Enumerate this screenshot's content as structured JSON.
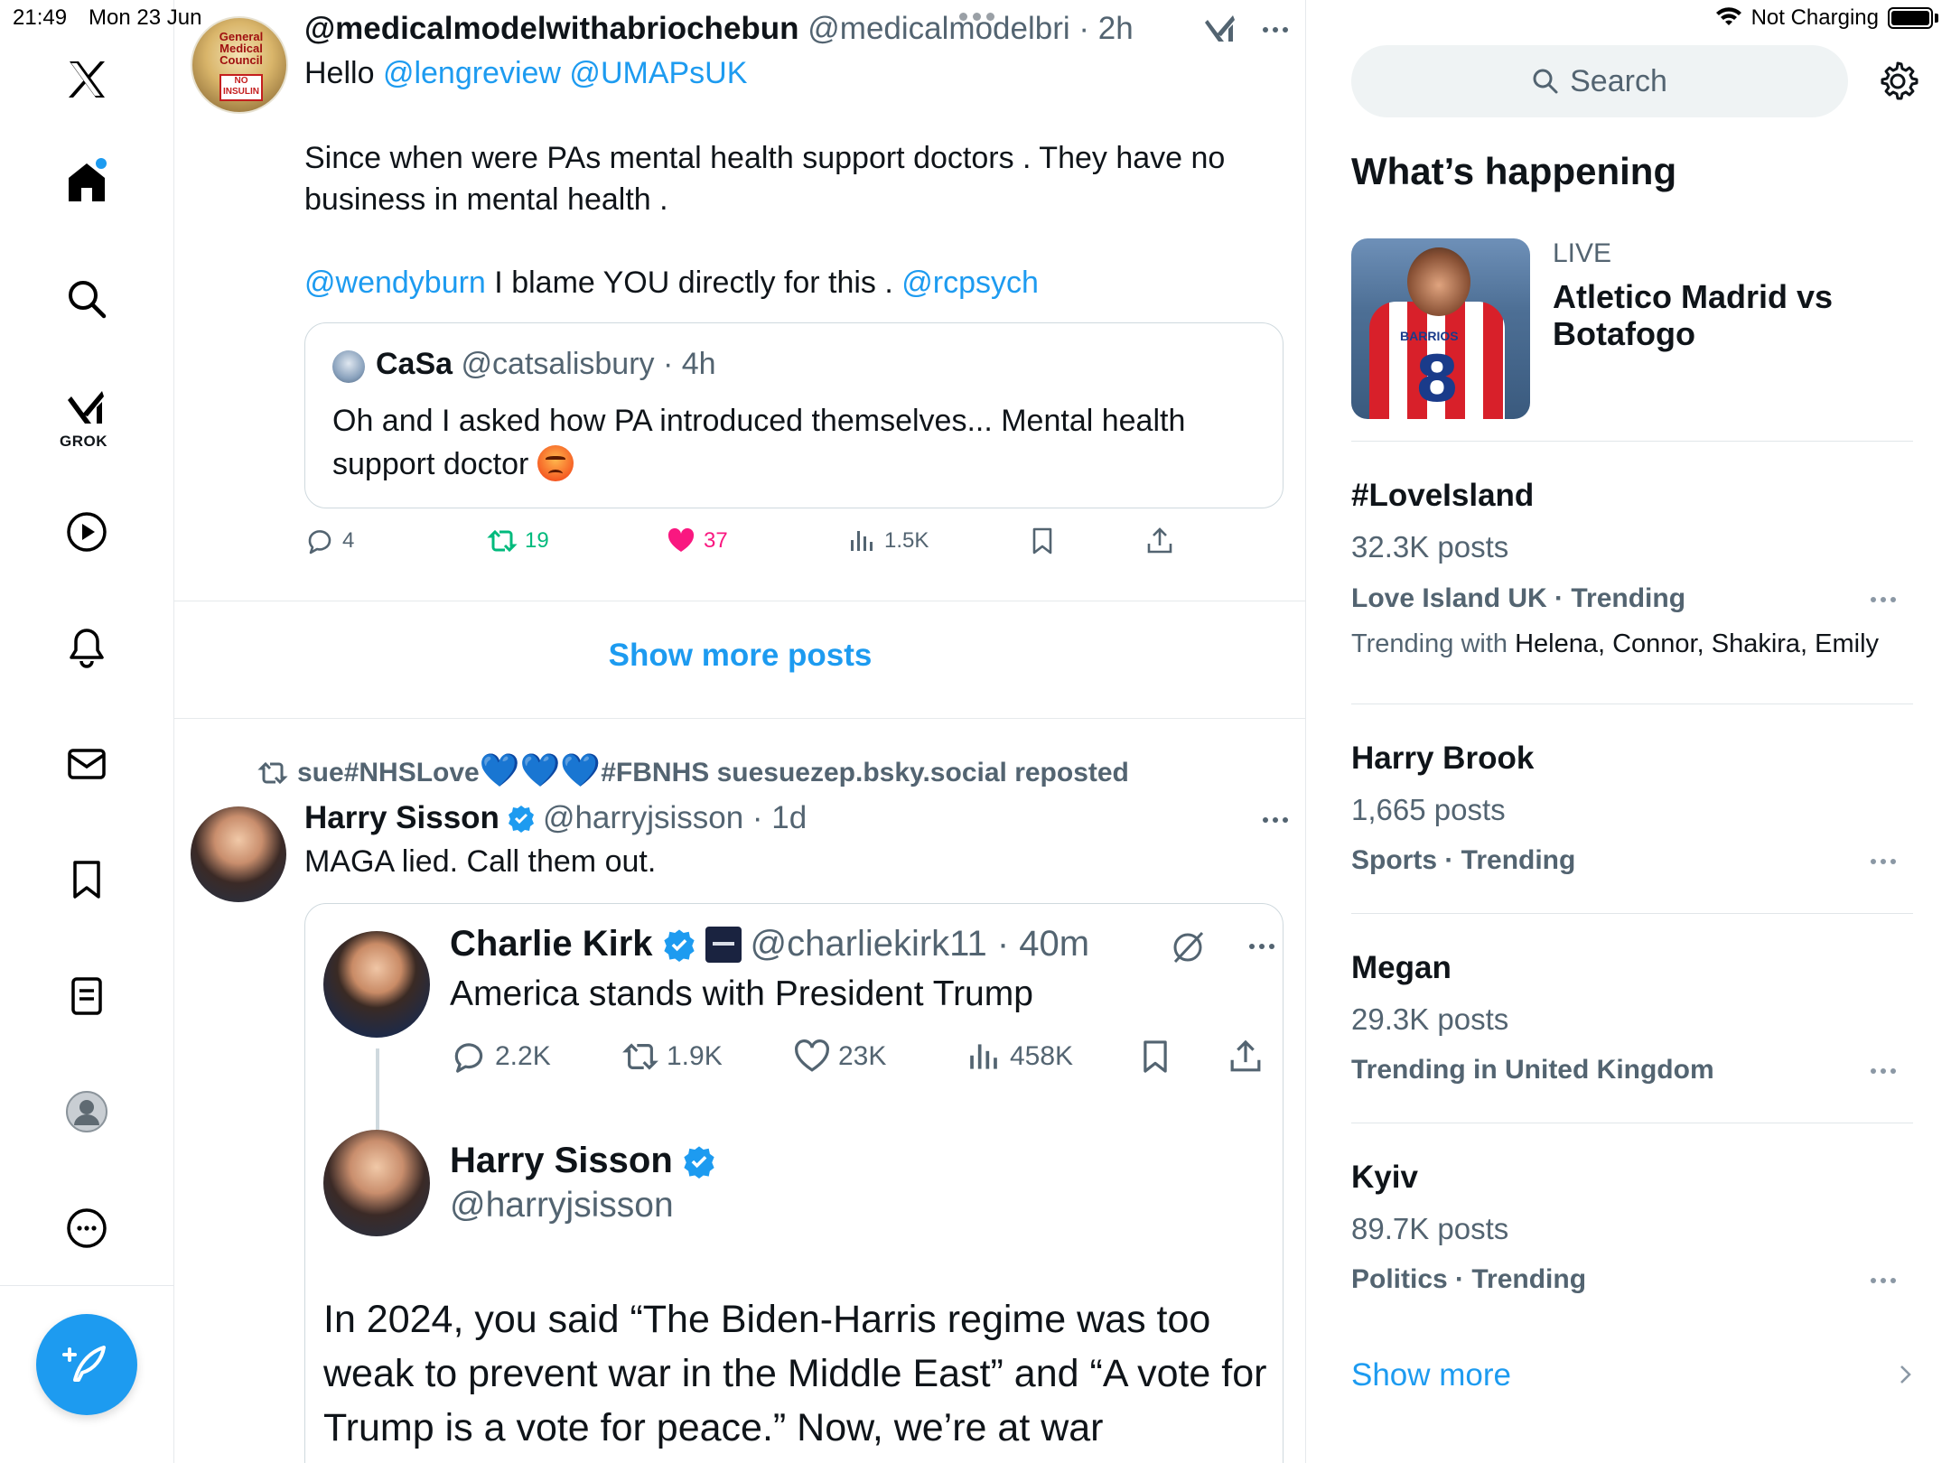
{
  "status_bar": {
    "time": "21:49",
    "date": "Mon 23 Jun",
    "charging": "Not Charging"
  },
  "nav": {
    "items": [
      {
        "name": "x-logo-icon"
      },
      {
        "name": "home-icon"
      },
      {
        "name": "explore-icon"
      },
      {
        "name": "grok-icon",
        "label": "GROK"
      },
      {
        "name": "video-icon"
      },
      {
        "name": "notifications-icon"
      },
      {
        "name": "messages-icon"
      },
      {
        "name": "bookmarks-icon"
      },
      {
        "name": "lists-icon"
      },
      {
        "name": "profile-icon"
      },
      {
        "name": "more-icon"
      }
    ],
    "compose_icon": "compose-icon"
  },
  "tweet1": {
    "display_name": "@medicalmodelwithabriochebun",
    "handle_time": "@medicalmodelbri · 2h",
    "avatar_text": "General Medical Council",
    "avatar_stamp": "NO INSULIN",
    "line1_prefix": "Hello ",
    "line1_mentions": "@lengreview @UMAPsUK",
    "body": "Since when were PAs mental health support doctors . They have no business in mental health .",
    "line3_mention": "@wendyburn",
    "line3_text": " I blame YOU directly for this . ",
    "line3_mention2": "@rcpsych",
    "quote": {
      "name": "CaSa",
      "handle_time": "@catsalisbury · 4h",
      "text": "Oh and I asked how PA introduced themselves... Mental health support doctor"
    },
    "actions": {
      "replies": "4",
      "reposts": "19",
      "likes": "37",
      "views": "1.5K"
    }
  },
  "show_more_posts": "Show more posts",
  "tweet2": {
    "repost_by": "sue#NHSLove",
    "repost_suffix": "#FBNHS suesuezep.bsky.social reposted",
    "hearts": "💙💙💙",
    "display_name": "Harry Sisson",
    "handle_time": "@harryjsisson · 1d",
    "text": "MAGA lied. Call them out.",
    "quoted": {
      "name": "Charlie Kirk",
      "handle_time": "@charliekirk11 · 40m",
      "text": "America stands with President Trump",
      "actions": {
        "replies": "2.2K",
        "reposts": "1.9K",
        "likes": "23K",
        "views": "458K"
      },
      "reply_name": "Harry Sisson",
      "reply_handle": "@harryjsisson",
      "reply_text": "In 2024, you said “The Biden-Harris regime was too weak to prevent war in the Middle East” and “A vote for Trump is a vote for peace.” Now, we’re at war"
    }
  },
  "sidebar": {
    "search_placeholder": "Search",
    "whats_happening": "What’s happening",
    "live": {
      "label": "LIVE",
      "title": "Atletico Madrid vs Botafogo",
      "shirt_name": "BARRIOS",
      "shirt_number": "8"
    },
    "trends": [
      {
        "title": "#LoveIsland",
        "posts": "32.3K posts",
        "meta": "Love Island UK · Trending",
        "with_label": "Trending with ",
        "with": "Helena, Connor, Shakira, Emily"
      },
      {
        "title": "Harry Brook",
        "posts": "1,665 posts",
        "meta": "Sports · Trending"
      },
      {
        "title": "Megan",
        "posts": "29.3K posts",
        "meta": "Trending in United Kingdom"
      },
      {
        "title": "Kyiv",
        "posts": "89.7K posts",
        "meta": "Politics · Trending"
      }
    ],
    "show_more": "Show more"
  },
  "colors": {
    "accent": "#1d9bf0",
    "repost_green": "#00ba7c",
    "like_pink": "#f91880",
    "muted": "#536471"
  }
}
